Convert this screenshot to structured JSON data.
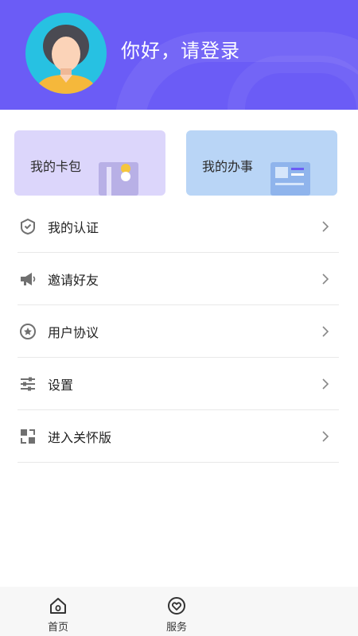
{
  "header": {
    "greeting": "你好，请登录",
    "avatar_icon": "user-avatar-icon",
    "bg_color": "#6b5cf6"
  },
  "cards": [
    {
      "label": "我的卡包",
      "icon": "card-wallet-icon",
      "bg_color": "#dcd6fb"
    },
    {
      "label": "我的办事",
      "icon": "document-icon",
      "bg_color": "#b9d5f6"
    }
  ],
  "menu": [
    {
      "label": "我的认证",
      "icon": "verify-shield-icon"
    },
    {
      "label": "邀请好友",
      "icon": "megaphone-icon"
    },
    {
      "label": "用户协议",
      "icon": "star-badge-icon"
    },
    {
      "label": "设置",
      "icon": "sliders-icon"
    },
    {
      "label": "进入关怀版",
      "icon": "care-mode-icon"
    }
  ],
  "tabbar": [
    {
      "label": "首页",
      "icon": "home-icon"
    },
    {
      "label": "服务",
      "icon": "service-icon"
    }
  ]
}
